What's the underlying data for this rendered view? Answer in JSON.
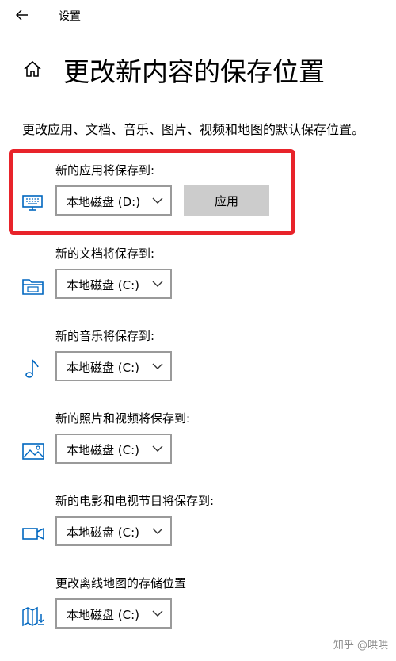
{
  "header": {
    "title": "设置"
  },
  "page": {
    "title": "更改新内容的保存位置",
    "description": "更改应用、文档、音乐、图片、视频和地图的默认保存位置。"
  },
  "sections": [
    {
      "label": "新的应用将保存到:",
      "value": "本地磁盘 (D:)",
      "icon": "monitor-icon",
      "apply_label": "应用"
    },
    {
      "label": "新的文档将保存到:",
      "value": "本地磁盘 (C:)",
      "icon": "folder-icon"
    },
    {
      "label": "新的音乐将保存到:",
      "value": "本地磁盘 (C:)",
      "icon": "music-note-icon"
    },
    {
      "label": "新的照片和视频将保存到:",
      "value": "本地磁盘 (C:)",
      "icon": "picture-icon"
    },
    {
      "label": "新的电影和电视节目将保存到:",
      "value": "本地磁盘 (C:)",
      "icon": "video-camera-icon"
    },
    {
      "label": "更改离线地图的存储位置",
      "value": "本地磁盘 (C:)",
      "icon": "map-download-icon"
    }
  ],
  "watermark": "知乎 @哄哄",
  "colors": {
    "accent": "#0067c0",
    "highlight": "#e8232a",
    "button_bg": "#cccccc",
    "border": "#9a9a9a"
  }
}
